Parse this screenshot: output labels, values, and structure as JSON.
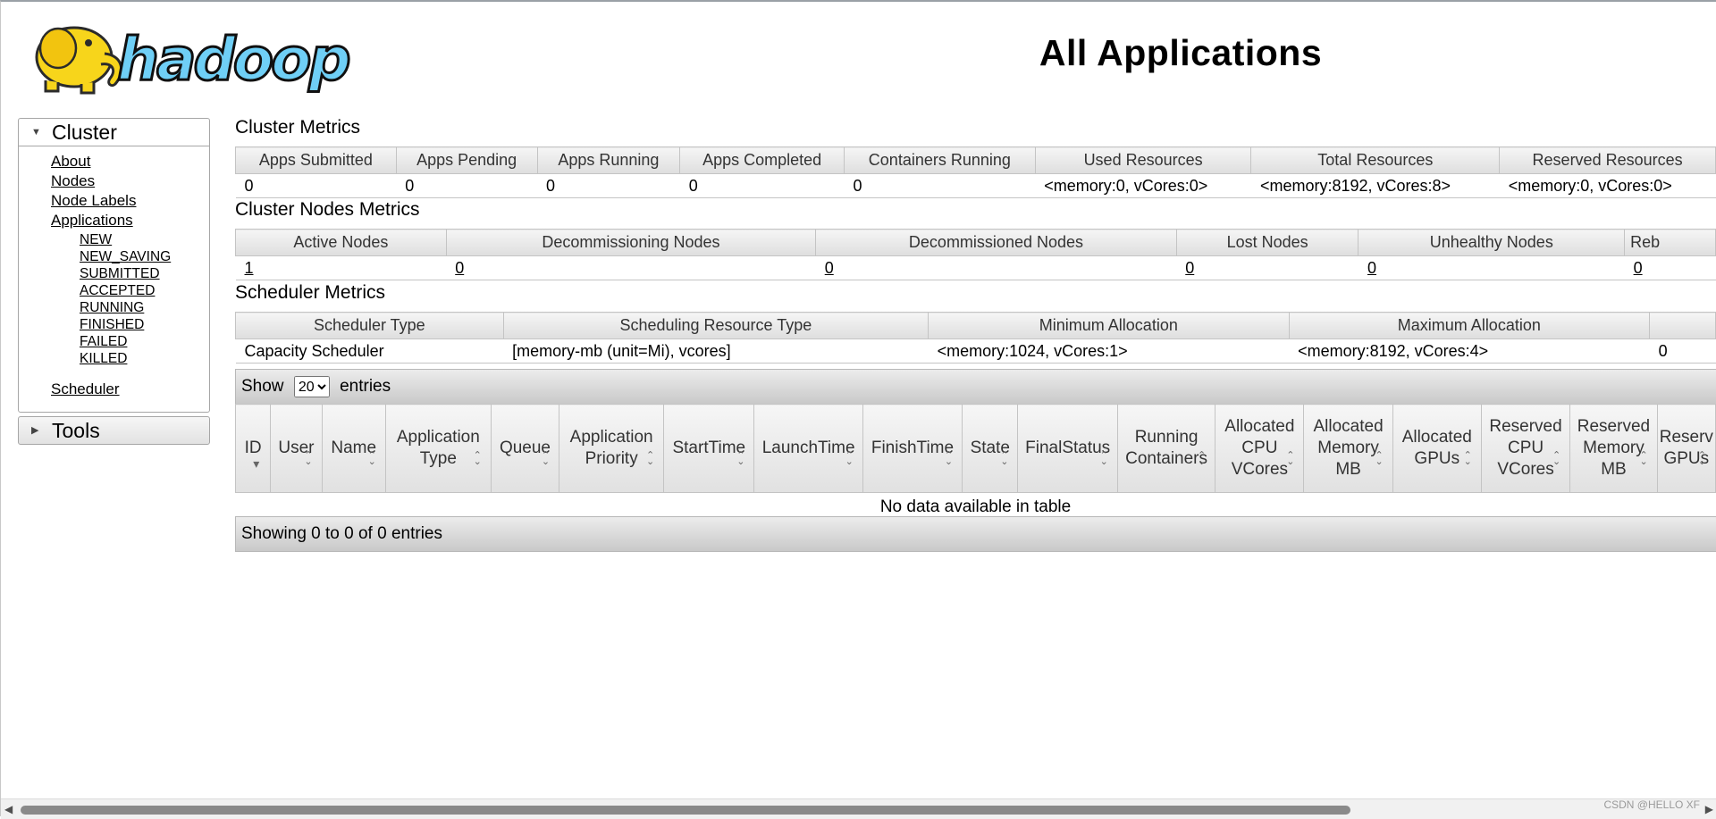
{
  "page": {
    "title": "All Applications"
  },
  "logo": {
    "text": "hadoop"
  },
  "sidebar": {
    "cluster": {
      "header": "Cluster",
      "links": [
        "About",
        "Nodes",
        "Node Labels",
        "Applications"
      ],
      "app_states": [
        "NEW",
        "NEW_SAVING",
        "SUBMITTED",
        "ACCEPTED",
        "RUNNING",
        "FINISHED",
        "FAILED",
        "KILLED"
      ],
      "scheduler": "Scheduler"
    },
    "tools": {
      "header": "Tools"
    }
  },
  "cluster_metrics": {
    "title": "Cluster Metrics",
    "headers": [
      "Apps Submitted",
      "Apps Pending",
      "Apps Running",
      "Apps Completed",
      "Containers Running",
      "Used Resources",
      "Total Resources",
      "Reserved Resources"
    ],
    "values": [
      "0",
      "0",
      "0",
      "0",
      "0",
      "<memory:0, vCores:0>",
      "<memory:8192, vCores:8>",
      "<memory:0, vCores:0>"
    ]
  },
  "cluster_nodes_metrics": {
    "title": "Cluster Nodes Metrics",
    "headers": [
      "Active Nodes",
      "Decommissioning Nodes",
      "Decommissioned Nodes",
      "Lost Nodes",
      "Unhealthy Nodes",
      "Reb"
    ],
    "values": [
      "1",
      "0",
      "0",
      "0",
      "0",
      "0"
    ]
  },
  "scheduler_metrics": {
    "title": "Scheduler Metrics",
    "headers": [
      "Scheduler Type",
      "Scheduling Resource Type",
      "Minimum Allocation",
      "Maximum Allocation",
      ""
    ],
    "values": [
      "Capacity Scheduler",
      "[memory-mb (unit=Mi), vcores]",
      "<memory:1024, vCores:1>",
      "<memory:8192, vCores:4>",
      "0"
    ]
  },
  "apps_table": {
    "show_label": "Show",
    "entries_label": "entries",
    "page_size": "20",
    "columns": [
      [
        "ID"
      ],
      [
        "User"
      ],
      [
        "Name"
      ],
      [
        "Application",
        "Type"
      ],
      [
        "Queue"
      ],
      [
        "Application",
        "Priority"
      ],
      [
        "StartTime"
      ],
      [
        "LaunchTime"
      ],
      [
        "FinishTime"
      ],
      [
        "State"
      ],
      [
        "FinalStatus"
      ],
      [
        "Running",
        "Containers"
      ],
      [
        "Allocated",
        "CPU",
        "VCores"
      ],
      [
        "Allocated",
        "Memory",
        "MB"
      ],
      [
        "Allocated",
        "GPUs"
      ],
      [
        "Reserved",
        "CPU",
        "VCores"
      ],
      [
        "Reserved",
        "Memory",
        "MB"
      ],
      [
        "Reserv",
        "GPUs"
      ]
    ],
    "empty_message": "No data available in table",
    "footer": "Showing 0 to 0 of 0 entries"
  },
  "watermark": "CSDN @HELLO XF"
}
